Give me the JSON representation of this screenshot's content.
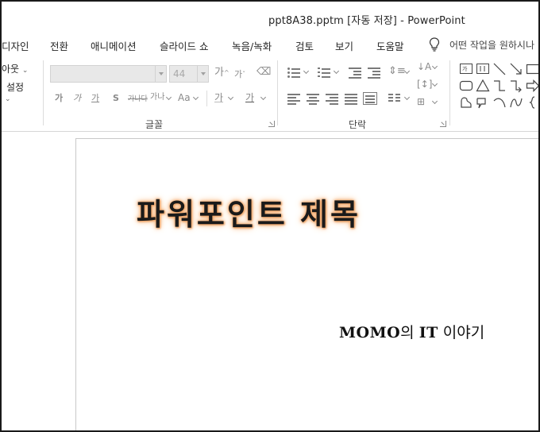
{
  "window": {
    "title": "ppt8A38.pptm [자동 저장]  -  PowerPoint"
  },
  "tabs": [
    {
      "label": "디자인"
    },
    {
      "label": "전환"
    },
    {
      "label": "애니메이션"
    },
    {
      "label": "슬라이드 쇼"
    },
    {
      "label": "녹음/녹화"
    },
    {
      "label": "검토"
    },
    {
      "label": "보기"
    },
    {
      "label": "도움말"
    }
  ],
  "tell_me": {
    "placeholder": "어떤 작업을 원하시나",
    "icon": "lightbulb-icon"
  },
  "ribbon": {
    "slides_group": {
      "layout_label": "아웃",
      "reset_label": "설정"
    },
    "font_group": {
      "label": "글꼴",
      "font_name": "",
      "font_size": "44",
      "grow_label": "가",
      "shrink_label": "가",
      "bold_label": "가",
      "italic_label": "가",
      "underline_label": "가",
      "shadow_label": "S",
      "strike_label": "가나다",
      "spacing_label": "가나",
      "case_label": "Aa",
      "highlight_label": "가",
      "color_label": "가"
    },
    "paragraph_group": {
      "label": "단락"
    }
  },
  "slide": {
    "title": "파워포인트 제목",
    "subtitle_parts": [
      {
        "text": "MOMO",
        "style": "logo"
      },
      {
        "text": "의 ",
        "style": "plain"
      },
      {
        "text": "IT",
        "style": "logo"
      },
      {
        "text": " 이야기",
        "style": "plain"
      }
    ]
  },
  "colors": {
    "title_glow": "#f4b078",
    "text": "#262626",
    "disabled": "#a8a8a8"
  }
}
